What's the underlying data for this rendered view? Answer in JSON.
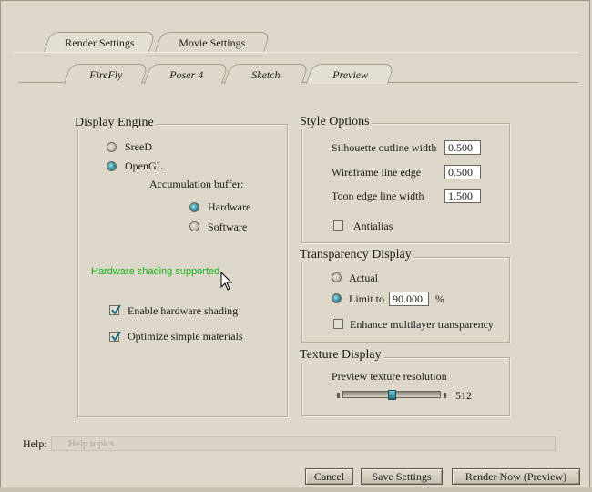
{
  "main_tabs": [
    "Render Settings",
    "Movie Settings"
  ],
  "sub_tabs": [
    "FireFly",
    "Poser 4",
    "Sketch",
    "Preview"
  ],
  "display_engine": {
    "title": "Display Engine",
    "sreed": "SreeD",
    "opengl": "OpenGL",
    "accumulation_label": "Accumulation buffer:",
    "hardware": "Hardware",
    "software": "Software",
    "status": "Hardware shading supported",
    "enable_hw_shading": "Enable hardware shading",
    "optimize_materials": "Optimize simple materials"
  },
  "style_options": {
    "title": "Style Options",
    "silhouette_label": "Silhouette outline width",
    "silhouette_value": "0.500",
    "wireframe_label": "Wireframe line edge",
    "wireframe_value": "0.500",
    "toon_label": "Toon edge line width",
    "toon_value": "1.500",
    "antialias": "Antialias"
  },
  "transparency": {
    "title": "Transparency Display",
    "actual": "Actual",
    "limit_to": "Limit to",
    "limit_value": "90.000",
    "percent": "%",
    "enhance": "Enhance multilayer transparency"
  },
  "texture": {
    "title": "Texture Display",
    "label": "Preview texture resolution",
    "value": "512",
    "slider_position": 0.5
  },
  "help": {
    "label": "Help:",
    "placeholder": "Help topics"
  },
  "buttons": {
    "cancel": "Cancel",
    "save": "Save Settings",
    "render": "Render Now (Preview)"
  },
  "state": {
    "engine": "OpenGL",
    "accumulation": "Hardware",
    "enable_hw_shading": true,
    "optimize_materials": true,
    "antialias": false,
    "transparency": "Limit to",
    "enhance": false
  },
  "colors": {
    "background": "#ddd8c9",
    "status_green": "#18b018",
    "radio_selected": "#2f8a96"
  }
}
